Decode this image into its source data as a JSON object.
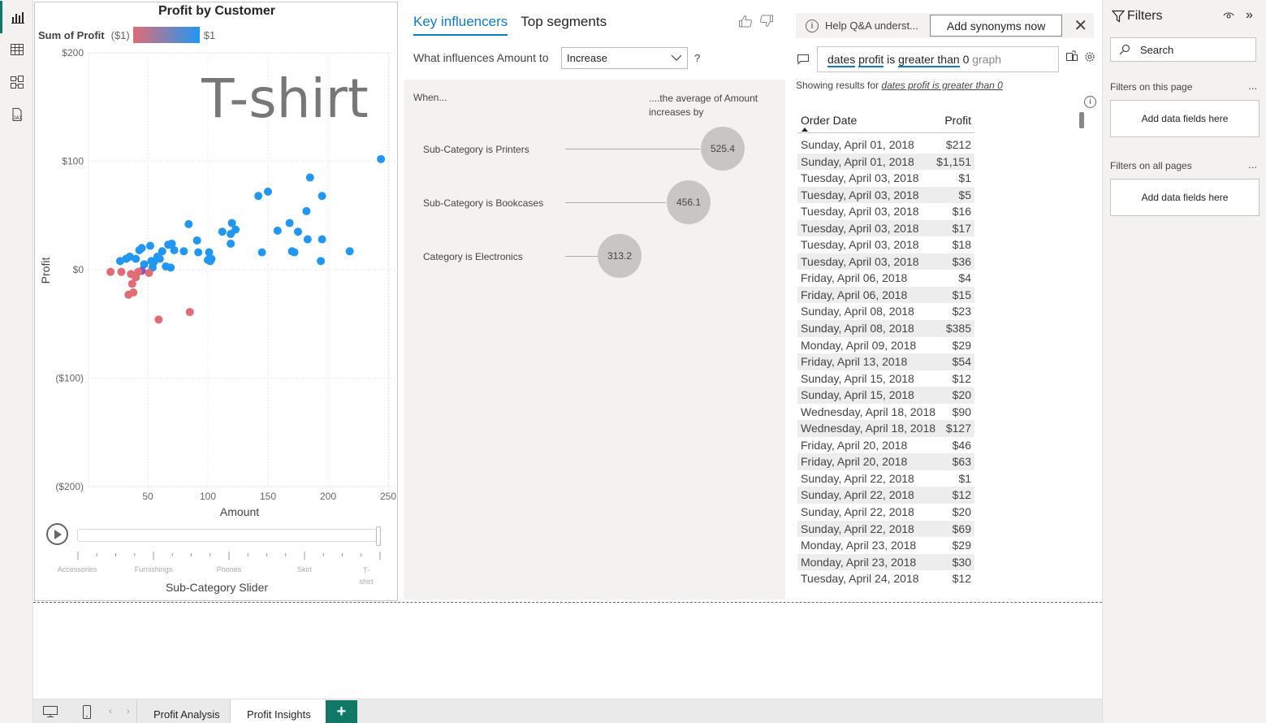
{
  "rail": {
    "icons": [
      "report-view-icon",
      "data-view-icon",
      "model-view-icon",
      "dax-query-icon"
    ]
  },
  "scatter": {
    "title": "Profit by Customer",
    "legend_label": "Sum of Profit",
    "legend_min": "($1)",
    "legend_max": "$1",
    "watermark": "T-shirt",
    "slider_caption": "Sub-Category Slider",
    "slider_labels": [
      "Accessories",
      "Furnishings",
      "Phones",
      "Skirt",
      "T-shirt"
    ],
    "play_icon": "play-icon",
    "colors": {
      "negative": "#e06c75",
      "positive": "#2196f3"
    }
  },
  "chart_data": {
    "type": "scatter",
    "title": "Profit by Customer",
    "xlabel": "Amount",
    "ylabel": "Profit",
    "xlim": [
      0,
      250
    ],
    "ylim": [
      -200,
      200
    ],
    "x_ticks": [
      "50",
      "100",
      "150",
      "200",
      "250"
    ],
    "y_ticks": [
      "$200",
      "$100",
      "$0",
      "($100)",
      "($200)"
    ],
    "y_tick_values": [
      200,
      100,
      0,
      -100,
      -200
    ],
    "x_tick_values": [
      50,
      100,
      150,
      200,
      250
    ],
    "grid": true,
    "series": [
      {
        "color": "#2196f3",
        "points": [
          [
            244,
            102
          ],
          [
            185,
            85
          ],
          [
            150,
            72
          ],
          [
            142,
            68
          ],
          [
            195,
            68
          ],
          [
            182,
            54
          ],
          [
            168,
            43
          ],
          [
            84,
            42
          ],
          [
            120,
            43
          ],
          [
            123,
            37
          ],
          [
            112,
            35
          ],
          [
            119,
            33
          ],
          [
            175,
            35
          ],
          [
            158,
            36
          ],
          [
            195,
            28
          ],
          [
            183,
            28
          ],
          [
            91,
            27
          ],
          [
            119,
            24
          ],
          [
            67,
            23
          ],
          [
            70,
            24
          ],
          [
            52,
            22
          ],
          [
            45,
            20
          ],
          [
            43,
            18
          ],
          [
            72,
            18
          ],
          [
            62,
            17
          ],
          [
            80,
            17
          ],
          [
            92,
            16
          ],
          [
            101,
            16
          ],
          [
            145,
            16
          ],
          [
            170,
            17
          ],
          [
            172,
            16
          ],
          [
            218,
            17
          ],
          [
            35,
            12
          ],
          [
            58,
            12
          ],
          [
            32,
            10
          ],
          [
            40,
            10
          ],
          [
            60,
            10
          ],
          [
            103,
            10
          ],
          [
            100,
            9
          ],
          [
            53,
            8
          ],
          [
            55,
            7
          ],
          [
            27,
            8
          ],
          [
            194,
            8
          ],
          [
            102,
            8
          ],
          [
            47,
            5
          ],
          [
            69,
            2
          ],
          [
            65,
            3
          ],
          [
            54,
            2
          ]
        ]
      },
      {
        "color": "#7e57c2",
        "points": [
          [
            45,
            -1
          ]
        ]
      },
      {
        "color": "#e06c75",
        "points": [
          [
            19,
            -2
          ],
          [
            28,
            -2
          ],
          [
            36,
            -4
          ],
          [
            42,
            -2
          ],
          [
            40,
            -7
          ],
          [
            51,
            -3
          ],
          [
            37,
            -13
          ],
          [
            34,
            -23
          ],
          [
            38,
            -21
          ],
          [
            85,
            -39
          ],
          [
            59,
            -46
          ]
        ]
      }
    ]
  },
  "key_influencers": {
    "tab_active": "Key influencers",
    "tab_other": "Top segments",
    "question": "What influences Amount to",
    "select_value": "Increase",
    "qmark": "?",
    "when": "When...",
    "avg_text": "....the average of Amount increases by",
    "rows": [
      {
        "label": "Sub-Category is Printers",
        "value": "525.4"
      },
      {
        "label": "Sub-Category is Bookcases",
        "value": "456.1"
      },
      {
        "label": "Category is Electronics",
        "value": "313.2"
      }
    ]
  },
  "qa": {
    "banner_text": "Help Q&A underst...",
    "banner_button": "Add synonyms now",
    "query_parts": [
      "dates",
      "profit",
      "is",
      "greater than",
      "0",
      "graph"
    ],
    "showing_prefix": "Showing results for",
    "showing_query": "dates profit is greater than 0",
    "columns": [
      "Order Date",
      "Profit"
    ],
    "rows": [
      [
        "Sunday, April 01, 2018",
        "$212"
      ],
      [
        "Sunday, April 01, 2018",
        "$1,151"
      ],
      [
        "Tuesday, April 03, 2018",
        "$1"
      ],
      [
        "Tuesday, April 03, 2018",
        "$5"
      ],
      [
        "Tuesday, April 03, 2018",
        "$16"
      ],
      [
        "Tuesday, April 03, 2018",
        "$17"
      ],
      [
        "Tuesday, April 03, 2018",
        "$18"
      ],
      [
        "Tuesday, April 03, 2018",
        "$36"
      ],
      [
        "Friday, April 06, 2018",
        "$4"
      ],
      [
        "Friday, April 06, 2018",
        "$15"
      ],
      [
        "Sunday, April 08, 2018",
        "$23"
      ],
      [
        "Sunday, April 08, 2018",
        "$385"
      ],
      [
        "Monday, April 09, 2018",
        "$29"
      ],
      [
        "Friday, April 13, 2018",
        "$54"
      ],
      [
        "Sunday, April 15, 2018",
        "$12"
      ],
      [
        "Sunday, April 15, 2018",
        "$20"
      ],
      [
        "Wednesday, April 18, 2018",
        "$90"
      ],
      [
        "Wednesday, April 18, 2018",
        "$127"
      ],
      [
        "Friday, April 20, 2018",
        "$46"
      ],
      [
        "Friday, April 20, 2018",
        "$63"
      ],
      [
        "Sunday, April 22, 2018",
        "$1"
      ],
      [
        "Sunday, April 22, 2018",
        "$12"
      ],
      [
        "Sunday, April 22, 2018",
        "$20"
      ],
      [
        "Sunday, April 22, 2018",
        "$69"
      ],
      [
        "Monday, April 23, 2018",
        "$29"
      ],
      [
        "Monday, April 23, 2018",
        "$30"
      ],
      [
        "Tuesday, April 24, 2018",
        "$12"
      ]
    ]
  },
  "filters": {
    "title": "Filters",
    "search_placeholder": "Search",
    "on_this_page": "Filters on this page",
    "on_all_pages": "Filters on all pages",
    "add_fields": "Add data fields here",
    "dots": "..."
  },
  "pages": {
    "tabs": [
      "Profit Analysis",
      "Profit Insights"
    ],
    "active": "Profit Insights",
    "add": "+"
  }
}
